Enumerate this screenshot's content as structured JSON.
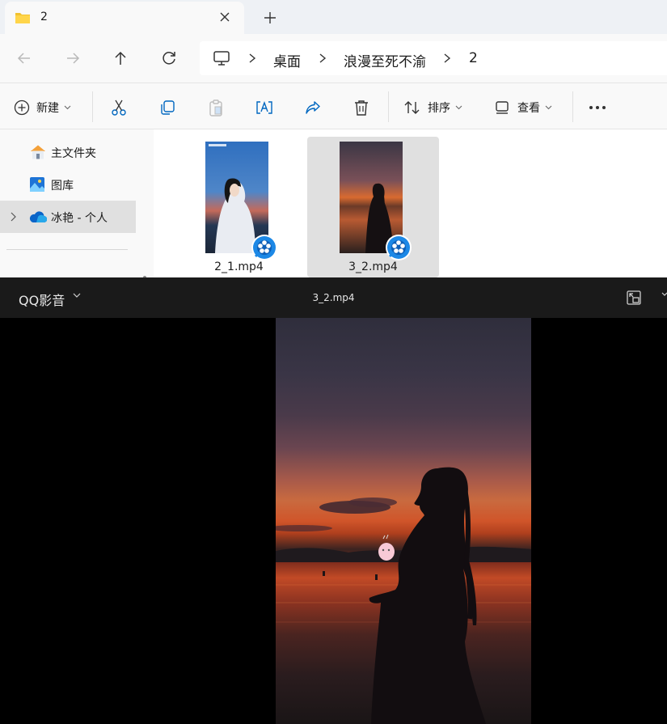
{
  "tab": {
    "title": "2",
    "folder_icon": "folder-icon",
    "close_icon": "close-icon",
    "new_tab_icon": "plus-icon"
  },
  "nav": {
    "back_icon": "back-arrow-icon",
    "forward_icon": "forward-arrow-icon",
    "up_icon": "up-arrow-icon",
    "refresh_icon": "refresh-icon",
    "breadcrumbs": [
      "桌面",
      "浪漫至死不渝",
      "2"
    ]
  },
  "toolbar": {
    "new_label": "新建",
    "sort_label": "排序",
    "view_label": "查看"
  },
  "sidebar": {
    "items": [
      {
        "label": "主文件夹",
        "icon": "home-icon"
      },
      {
        "label": "图库",
        "icon": "gallery-icon"
      },
      {
        "label": "冰艳 - 个人",
        "icon": "onedrive-cloud-icon"
      }
    ]
  },
  "files": [
    {
      "name": "2_1.mp4",
      "selected": false
    },
    {
      "name": "3_2.mp4",
      "selected": true
    }
  ],
  "player": {
    "brand": "QQ影音",
    "title": "3_2.mp4"
  },
  "colors": {
    "accent": "#0067c0",
    "player_bg": "#000000",
    "player_bar": "#1a1a1a",
    "badge_blue": "#1c88e6"
  }
}
